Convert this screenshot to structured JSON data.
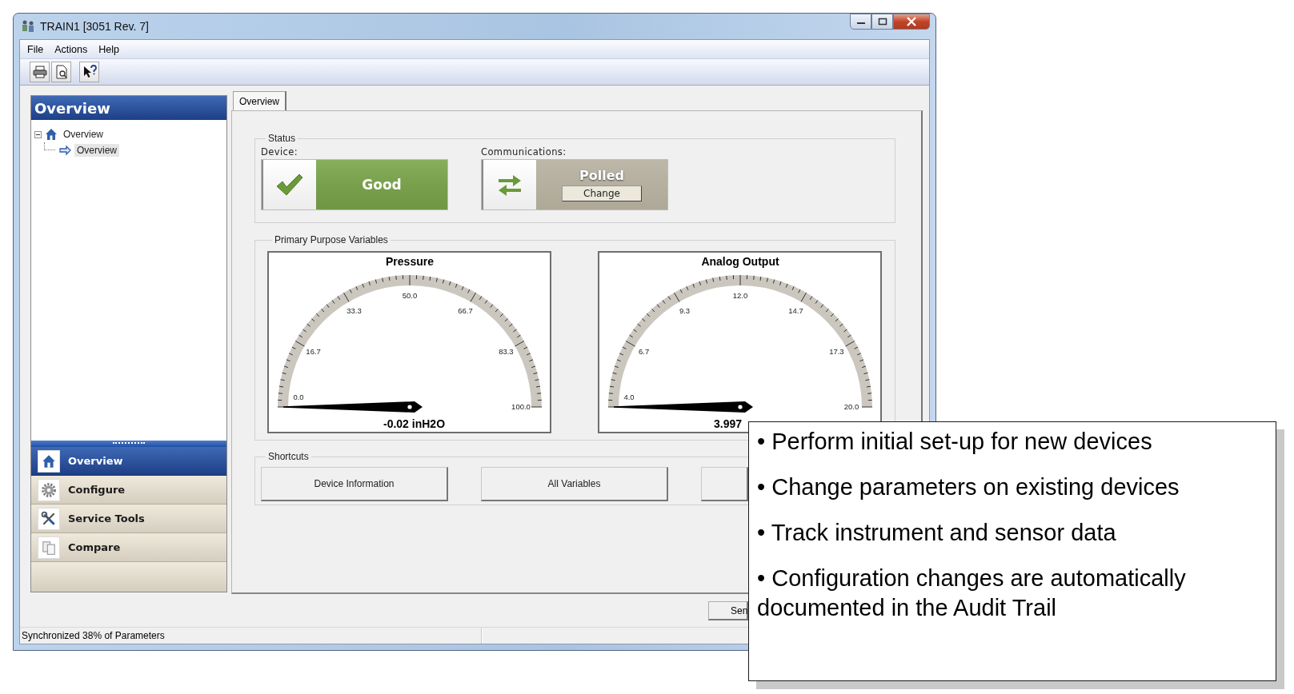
{
  "window": {
    "title": "TRAIN1 [3051 Rev. 7]"
  },
  "menu": [
    "File",
    "Actions",
    "Help"
  ],
  "sidebar": {
    "title": "Overview",
    "tree": [
      {
        "label": "Overview",
        "kind": "home",
        "expanded": true,
        "selected": false,
        "children": [
          {
            "label": "Overview",
            "kind": "arrow",
            "selected": true
          }
        ]
      }
    ],
    "nav": [
      {
        "label": "Overview",
        "kind": "home",
        "selected": true
      },
      {
        "label": "Configure",
        "kind": "gear",
        "selected": false
      },
      {
        "label": "Service Tools",
        "kind": "tools",
        "selected": false
      },
      {
        "label": "Compare",
        "kind": "pages",
        "selected": false
      }
    ]
  },
  "tabs": [
    {
      "label": "Overview",
      "selected": true
    }
  ],
  "status": {
    "title": "Status",
    "device": {
      "label": "Device:",
      "value": "Good"
    },
    "communications": {
      "label": "Communications:",
      "value": "Polled",
      "button": "Change"
    }
  },
  "variables": {
    "title": "Primary Purpose Variables",
    "gauges": [
      {
        "title": "Pressure",
        "ticks": [
          "0.0",
          "16.7",
          "33.3",
          "50.0",
          "66.7",
          "83.3",
          "100.0"
        ],
        "reading": "-0.02 inH2O"
      },
      {
        "title": "Analog Output",
        "ticks": [
          "4.0",
          "6.7",
          "9.3",
          "12.0",
          "14.7",
          "17.3",
          "20.0"
        ],
        "reading": "3.997"
      }
    ]
  },
  "shortcuts": {
    "title": "Shortcuts",
    "buttons": [
      {
        "label": "Device Information"
      },
      {
        "label": "All Variables"
      },
      {
        "kind": "blank"
      }
    ]
  },
  "footer_buttons": [
    {
      "label": "Sen"
    }
  ],
  "status_bar": [
    {
      "text": "Synchronized 38% of Parameters"
    }
  ],
  "callout": {
    "bullets": [
      "• Perform initial set-up for new devices",
      "• Change parameters on existing devices",
      "• Track instrument and sensor data",
      "• Configuration changes are automatically documented in the Audit Trail"
    ]
  }
}
